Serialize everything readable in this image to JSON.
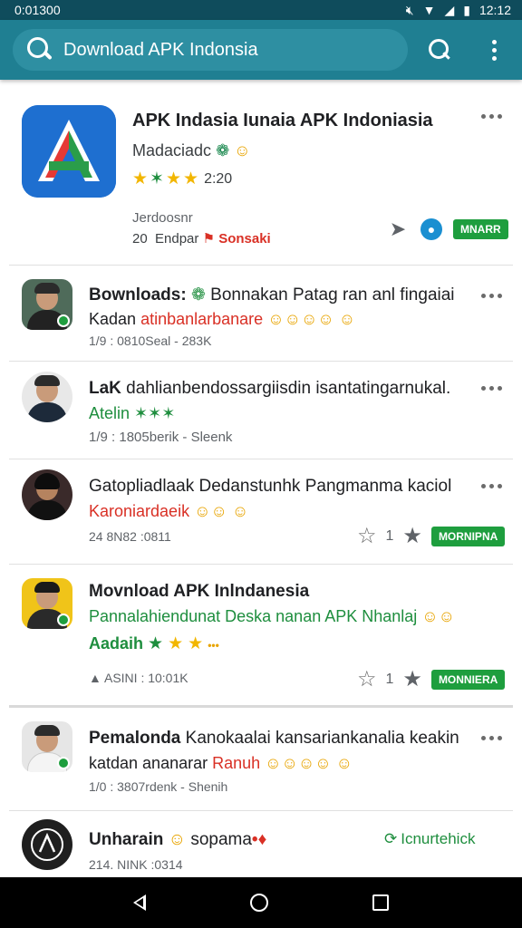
{
  "status": {
    "left_text": "0:01300",
    "time": "12:12"
  },
  "search": {
    "text": "Download APK Indonsia"
  },
  "featured": {
    "title": "APK Indasia Iunaia APK Indoniasia",
    "subtitle": "Madaciadc",
    "rating_value": "2:20",
    "developer": "Jerdoosnr",
    "meta_left": "20  Endpar",
    "meta_red": "Sonsaki",
    "action_label": "MNARR"
  },
  "items": [
    {
      "title_bold": "Bownloads:",
      "title_rest": " Bonnakan Patag ran anl fingaiai",
      "line2_plain": "Kadan ",
      "line2_red": "atinbanlarbanare",
      "line2_emoji": "☺☺☺☺ ☺",
      "meta": "1/9 : 0810Seal - 283K"
    },
    {
      "title_bold": "LaK",
      "title_rest": " dahlianbendossargiisdin isantatingarnukal.",
      "line2_green": "Atelin ✶✶✶",
      "meta": "1/9 : 1805berik - Sleenk"
    },
    {
      "title_bold": "",
      "title_rest": "Gatopliadlaak Dedanstunhk Pangmanma kaciol",
      "line2_red": "Karoniardaeik",
      "line2_emoji": "☺☺ ☺",
      "meta": "24 8N82 :0811",
      "count": "1",
      "action_label": "MORNIPNA"
    },
    {
      "title_bold": "Movnload APK Inlndanesia",
      "title_rest": "",
      "line2_green": "Pannalahiendunat Deska nanan APK Nhanlaj",
      "line2_emoji": "☺☺",
      "line3_green": "Aadaih",
      "meta": "ASINI : 10:01K",
      "count": "1",
      "action_label": "MONNIERA"
    },
    {
      "title_bold": "Pemalonda",
      "title_rest": " Kanokaalai kansariankanalia keakin",
      "line2_plain": "katdan ananarar ",
      "line2_red": "Ranuh",
      "line2_emoji": "☺☺☺☺ ☺",
      "meta": "1/0 : 3807rdenk - Shenih"
    },
    {
      "title_bold": "Unharain",
      "title_rest": " sopama",
      "meta": "214. NINK :0314",
      "action_label": "Icnurtehick"
    }
  ]
}
